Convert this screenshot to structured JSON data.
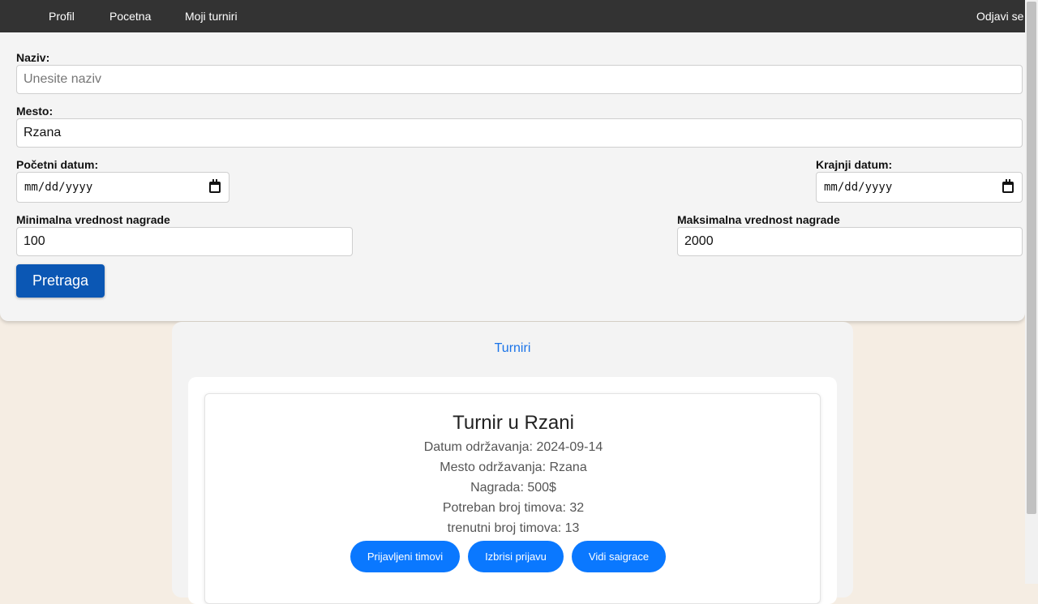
{
  "nav": {
    "profil": "Profil",
    "pocetna": "Pocetna",
    "moji_turniri": "Moji turniri",
    "logout": "Odjavi se"
  },
  "filters": {
    "naziv_label": "Naziv:",
    "naziv_placeholder": "Unesite naziv",
    "naziv_value": "",
    "mesto_label": "Mesto:",
    "mesto_value": "Rzana",
    "pocetni_label": "Početni datum:",
    "pocetni_value": "mm/dd/yyyy",
    "krajnji_label": "Krajnji datum:",
    "krajnji_value": "mm/dd/yyyy",
    "min_label": "Minimalna vrednost nagrade",
    "min_value": "100",
    "max_label": "Maksimalna vrednost nagrade",
    "max_value": "2000",
    "search_button": "Pretraga"
  },
  "tournaments": {
    "section_title": "Turniri",
    "items": [
      {
        "title": "Turnir u Rzani",
        "datum": "Datum održavanja: 2024-09-14",
        "mesto": "Mesto održavanja: Rzana",
        "nagrada": "Nagrada: 500$",
        "potreban": "Potreban broj timova: 32",
        "trenutni": "trenutni broj timova: 13",
        "btn_prijavljeni": "Prijavljeni timovi",
        "btn_izbrisi": "Izbrisi prijavu",
        "btn_saigraci": "Vidi saigrace"
      }
    ]
  },
  "colors": {
    "navbar": "#333333",
    "primary_button": "#0b57b4",
    "card_button": "#0a78ff",
    "link": "#1a73e8",
    "page_background": "#f5ede3"
  }
}
